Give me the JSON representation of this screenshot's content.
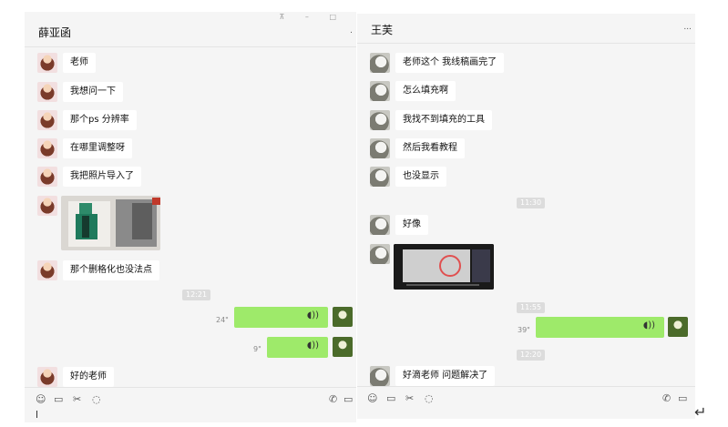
{
  "left": {
    "title": "薛亚函",
    "messages": [
      {
        "text": "老师"
      },
      {
        "text": "我想问一下"
      },
      {
        "text": "那个ps 分辨率"
      },
      {
        "text": "在哪里调整呀"
      },
      {
        "text": "我把照片导入了"
      },
      {
        "text": "那个删格化也没法点"
      },
      {
        "text": "好的老师"
      }
    ],
    "timestamp": "12:21",
    "voice": [
      {
        "duration": "24\""
      },
      {
        "duration": "9\""
      }
    ]
  },
  "right": {
    "title": "王芙",
    "more": "...",
    "messages": [
      {
        "text": "老师这个 我线稿画完了"
      },
      {
        "text": "怎么填充啊"
      },
      {
        "text": "我找不到填充的工具"
      },
      {
        "text": "然后我看教程"
      },
      {
        "text": "也没显示"
      },
      {
        "text": "好像"
      },
      {
        "text": "好滴老师 问题解决了"
      }
    ],
    "timestamps": [
      "11:30",
      "11:55",
      "12:20"
    ],
    "voice": {
      "duration": "39\""
    }
  },
  "colors": {
    "self_bubble": "#9eea6a",
    "panel_bg": "#f5f5f5",
    "bubble_in": "#ffffff"
  },
  "icons": [
    "emoji-icon",
    "folder-icon",
    "scissors-icon",
    "chat-bubble-icon",
    "phone-icon",
    "video-icon",
    "enter-icon"
  ]
}
